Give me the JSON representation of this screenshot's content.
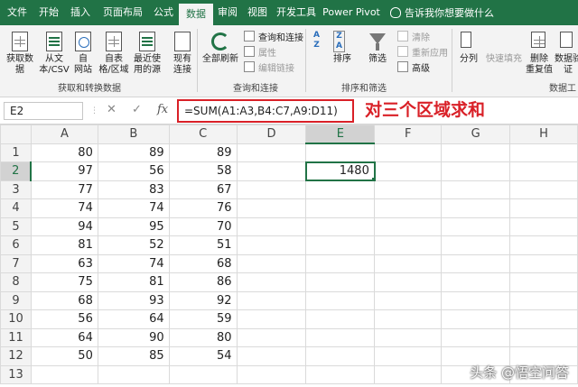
{
  "ribbon_tabs": [
    {
      "label": "文件"
    },
    {
      "label": "开始"
    },
    {
      "label": "插入"
    },
    {
      "label": "页面布局"
    },
    {
      "label": "公式"
    },
    {
      "label": "数据",
      "active": true
    },
    {
      "label": "审阅"
    },
    {
      "label": "视图"
    },
    {
      "label": "开发工具"
    },
    {
      "label": "Power Pivot"
    }
  ],
  "tell_me": "告诉我你想要做什么",
  "groups": {
    "get_transform": {
      "label": "获取和转换数据",
      "buttons": [
        {
          "label_l1": "获取数",
          "label_l2": "据",
          "icon": "database-icon"
        },
        {
          "label_l1": "从文",
          "label_l2": "本/CSV",
          "icon": "text-csv-icon"
        },
        {
          "label_l1": "自",
          "label_l2": "网站",
          "icon": "web-icon"
        },
        {
          "label_l1": "自表",
          "label_l2": "格/区域",
          "icon": "table-range-icon"
        },
        {
          "label_l1": "最近使",
          "label_l2": "用的源",
          "icon": "recent-sources-icon"
        },
        {
          "label_l1": "现有",
          "label_l2": "连接",
          "icon": "existing-connections-icon"
        }
      ]
    },
    "queries": {
      "label": "查询和连接",
      "refresh_l1": "全部刷新",
      "items": [
        {
          "label": "查询和连接",
          "disabled": false
        },
        {
          "label": "属性",
          "disabled": true
        },
        {
          "label": "编辑链接",
          "disabled": true
        }
      ]
    },
    "sort_filter": {
      "label": "排序和筛选",
      "sort_label": "排序",
      "filter_label": "筛选",
      "items": [
        {
          "label": "清除",
          "disabled": true
        },
        {
          "label": "重新应用",
          "disabled": true
        },
        {
          "label": "高级",
          "disabled": false
        }
      ]
    },
    "data_tools": {
      "label": "数据工",
      "buttons": [
        {
          "label_l1": "分列",
          "label_l2": ""
        },
        {
          "label_l1": "快速填充",
          "label_l2": ""
        },
        {
          "label_l1": "删除",
          "label_l2": "重复值"
        },
        {
          "label_l1": "数据验",
          "label_l2": "证"
        }
      ]
    }
  },
  "formula_bar": {
    "name_box": "E2",
    "cancel_symbol": "✕",
    "enter_symbol": "✓",
    "fx_symbol": "fx",
    "formula": "=SUM(A1:A3,B4:C7,A9:D11)"
  },
  "annotation": "对三个区域求和",
  "columns": [
    "A",
    "B",
    "C",
    "D",
    "E",
    "F",
    "G",
    "H"
  ],
  "rows": [
    {
      "n": "1",
      "cells": [
        "80",
        "89",
        "89",
        "",
        "",
        "",
        "",
        ""
      ]
    },
    {
      "n": "2",
      "cells": [
        "97",
        "56",
        "58",
        "",
        "1480",
        "",
        "",
        ""
      ]
    },
    {
      "n": "3",
      "cells": [
        "77",
        "83",
        "67",
        "",
        "",
        "",
        "",
        ""
      ]
    },
    {
      "n": "4",
      "cells": [
        "74",
        "74",
        "76",
        "",
        "",
        "",
        "",
        ""
      ]
    },
    {
      "n": "5",
      "cells": [
        "94",
        "95",
        "70",
        "",
        "",
        "",
        "",
        ""
      ]
    },
    {
      "n": "6",
      "cells": [
        "81",
        "52",
        "51",
        "",
        "",
        "",
        "",
        ""
      ]
    },
    {
      "n": "7",
      "cells": [
        "63",
        "74",
        "68",
        "",
        "",
        "",
        "",
        ""
      ]
    },
    {
      "n": "8",
      "cells": [
        "75",
        "81",
        "86",
        "",
        "",
        "",
        "",
        ""
      ]
    },
    {
      "n": "9",
      "cells": [
        "68",
        "93",
        "92",
        "",
        "",
        "",
        "",
        ""
      ]
    },
    {
      "n": "10",
      "cells": [
        "56",
        "64",
        "59",
        "",
        "",
        "",
        "",
        ""
      ]
    },
    {
      "n": "11",
      "cells": [
        "64",
        "90",
        "80",
        "",
        "",
        "",
        "",
        ""
      ]
    },
    {
      "n": "12",
      "cells": [
        "50",
        "85",
        "54",
        "",
        "",
        "",
        "",
        ""
      ]
    },
    {
      "n": "13",
      "cells": [
        "",
        "",
        "",
        "",
        "",
        "",
        "",
        ""
      ]
    }
  ],
  "active_cell": {
    "col": "E",
    "row": "2"
  },
  "watermark": "头条 @悟空问答",
  "colors": {
    "excel_green": "#217346",
    "annotation_red": "#d92027"
  }
}
